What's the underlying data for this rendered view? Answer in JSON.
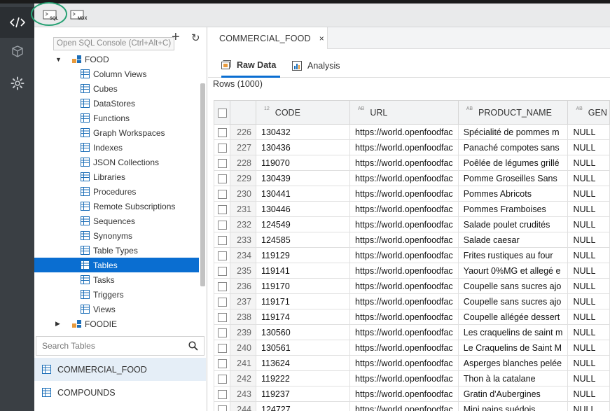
{
  "toolbar": {
    "sql_label": "SQL",
    "mdx_label": "MDX",
    "tooltip": "Open SQL Console (Ctrl+Alt+C)"
  },
  "tree": {
    "root": "FOOD",
    "items": [
      {
        "label": "Column Views",
        "icon": "column-views-icon"
      },
      {
        "label": "Cubes",
        "icon": "cube-icon"
      },
      {
        "label": "DataStores",
        "icon": "datastore-icon"
      },
      {
        "label": "Functions",
        "icon": "function-icon"
      },
      {
        "label": "Graph Workspaces",
        "icon": "graph-icon"
      },
      {
        "label": "Indexes",
        "icon": "index-icon"
      },
      {
        "label": "JSON Collections",
        "icon": "json-icon"
      },
      {
        "label": "Libraries",
        "icon": "library-icon"
      },
      {
        "label": "Procedures",
        "icon": "procedure-icon"
      },
      {
        "label": "Remote Subscriptions",
        "icon": "remote-icon"
      },
      {
        "label": "Sequences",
        "icon": "sequence-icon"
      },
      {
        "label": "Synonyms",
        "icon": "synonym-icon"
      },
      {
        "label": "Table Types",
        "icon": "table-type-icon"
      },
      {
        "label": "Tables",
        "icon": "table-icon",
        "selected": true
      },
      {
        "label": "Tasks",
        "icon": "task-icon"
      },
      {
        "label": "Triggers",
        "icon": "trigger-icon"
      },
      {
        "label": "Views",
        "icon": "view-icon"
      }
    ],
    "sibling": "FOODIE"
  },
  "search": {
    "placeholder": "Search Tables"
  },
  "results": [
    "COMMERCIAL_FOOD",
    "COMPOUNDS"
  ],
  "content": {
    "doc_tab": "COMMERCIAL_FOOD",
    "close": "×",
    "sub_tabs": [
      "Raw Data",
      "Analysis"
    ],
    "rows_count": "Rows (1000)"
  },
  "grid": {
    "columns": [
      {
        "name": "CODE",
        "type": "12"
      },
      {
        "name": "URL",
        "type": "AB"
      },
      {
        "name": "PRODUCT_NAME",
        "type": "AB"
      },
      {
        "name": "GEN",
        "type": "AB"
      }
    ],
    "rows": [
      [
        "226",
        "130432",
        "https://world.openfoodfac",
        "Spécialité de pommes m",
        "NULL"
      ],
      [
        "227",
        "130436",
        "https://world.openfoodfac",
        "Panaché compotes sans",
        "NULL"
      ],
      [
        "228",
        "119070",
        "https://world.openfoodfac",
        "Poêlée de légumes grillé",
        "NULL"
      ],
      [
        "229",
        "130439",
        "https://world.openfoodfac",
        "Pomme Groseilles Sans",
        "NULL"
      ],
      [
        "230",
        "130441",
        "https://world.openfoodfac",
        "Pommes Abricots",
        "NULL"
      ],
      [
        "231",
        "130446",
        "https://world.openfoodfac",
        "Pommes Framboises",
        "NULL"
      ],
      [
        "232",
        "124549",
        "https://world.openfoodfac",
        "Salade poulet crudités",
        "NULL"
      ],
      [
        "233",
        "124585",
        "https://world.openfoodfac",
        "Salade caesar",
        "NULL"
      ],
      [
        "234",
        "119129",
        "https://world.openfoodfac",
        "Frites rustiques au four",
        "NULL"
      ],
      [
        "235",
        "119141",
        "https://world.openfoodfac",
        "Yaourt 0%MG et allegé e",
        "NULL"
      ],
      [
        "236",
        "119170",
        "https://world.openfoodfac",
        "Coupelle sans sucres ajo",
        "NULL"
      ],
      [
        "237",
        "119171",
        "https://world.openfoodfac",
        "Coupelle sans sucres ajo",
        "NULL"
      ],
      [
        "238",
        "119174",
        "https://world.openfoodfac",
        "Coupelle allégée dessert",
        "NULL"
      ],
      [
        "239",
        "130560",
        "https://world.openfoodfac",
        "Les craquelins de saint m",
        "NULL"
      ],
      [
        "240",
        "130561",
        "https://world.openfoodfac",
        "Le Craquelins de Saint M",
        "NULL"
      ],
      [
        "241",
        "113624",
        "https://world.openfoodfac",
        "Asperges blanches pelée",
        "NULL"
      ],
      [
        "242",
        "119222",
        "https://world.openfoodfac",
        "Thon à la catalane",
        "NULL"
      ],
      [
        "243",
        "119237",
        "https://world.openfoodfac",
        "Gratin d'Aubergines",
        "NULL"
      ],
      [
        "244",
        "124727",
        "https://world.openfoodfac",
        "Mini pains suédois",
        "NULL"
      ]
    ]
  },
  "colors": {
    "accent": "#0a6ed1",
    "highlight_ring": "#26a173",
    "sidebar": "#3a3f44"
  }
}
